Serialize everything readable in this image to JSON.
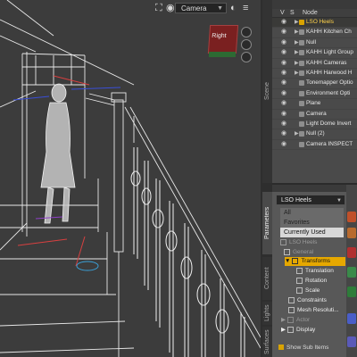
{
  "viewport": {
    "camera_label": "Camera",
    "navcube_label": "Right"
  },
  "tabs": {
    "scene": "Scene",
    "parameters": "Parameters",
    "content": "Content",
    "lights": "Lights",
    "surfaces": "Surfaces"
  },
  "scene": {
    "col_v": "V",
    "col_s": "S",
    "col_node": "Node",
    "nodes": [
      {
        "label": "LSO Heels",
        "selected": true
      },
      {
        "label": "KAHH Kitchen Ch",
        "selected": false
      },
      {
        "label": "Null",
        "selected": false
      },
      {
        "label": "KAHH Light Group",
        "selected": false
      },
      {
        "label": "KAHH Cameras",
        "selected": false
      },
      {
        "label": "KAHH Harwood H",
        "selected": false
      },
      {
        "label": "Tonemapper Optio",
        "selected": false
      },
      {
        "label": "Environment Opti",
        "selected": false
      },
      {
        "label": "Plane",
        "selected": false
      },
      {
        "label": "Camera",
        "selected": false
      },
      {
        "label": "Light Dome Invert",
        "selected": false
      },
      {
        "label": "Null (2)",
        "selected": false
      },
      {
        "label": "Camera INSPECT",
        "selected": false
      }
    ]
  },
  "parameters": {
    "selected_node": "LSO Heels",
    "filters": [
      "All",
      "Favorites",
      "Currently Used"
    ],
    "tree_root": "LSO Heels",
    "items": [
      "General",
      "Transforms",
      "Translation",
      "Rotation",
      "Scale",
      "Constraints",
      "Mesh Resoluti...",
      "Actor",
      "Display"
    ],
    "show_sub_items": "Show Sub Items"
  }
}
